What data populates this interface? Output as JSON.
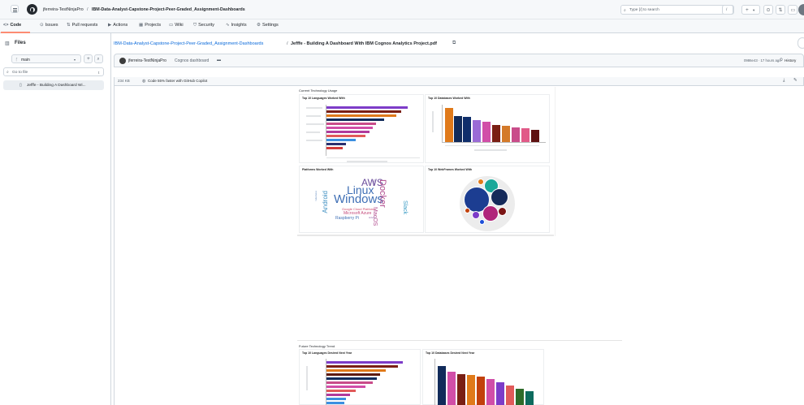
{
  "header": {
    "owner": "jferreira-TestNinjaPro",
    "separator": "/",
    "repo": "IBM-Data-Analyst-Capstone-Project-Peer-Graded_Assignment-Dashboards",
    "search_placeholder": "Type [/] to search",
    "search_hint": "/",
    "plus_label": "+",
    "caret": "▾"
  },
  "nav": {
    "tabs": [
      {
        "icon": "<>",
        "label": "Code"
      },
      {
        "icon": "⊙",
        "label": "Issues"
      },
      {
        "icon": "⇅",
        "label": "Pull requests"
      },
      {
        "icon": "▶",
        "label": "Actions"
      },
      {
        "icon": "▦",
        "label": "Projects"
      },
      {
        "icon": "▭",
        "label": "Wiki"
      },
      {
        "icon": "⛉",
        "label": "Security"
      },
      {
        "icon": "∿",
        "label": "Insights"
      },
      {
        "icon": "⚙",
        "label": "Settings"
      }
    ]
  },
  "sidebar": {
    "title": "Files",
    "branch": "main",
    "search_placeholder": "Go to file",
    "search_key": "t",
    "file": "Jefffe - Building A Dashboard Wi..."
  },
  "breadcrumb": {
    "repo": "IBM-Data-Analyst-Capstone-Project-Peer-Graded_Assignment-Dashboards",
    "sep": "/",
    "file": "Jefffe - Building A Dashboard With IBM Cognos Analytics Project.pdf"
  },
  "commit": {
    "author": "jferreira-TestNinjaPro",
    "message": "Cognos dashboard",
    "hash": "0986e43 · 17 hours ago",
    "history": "History"
  },
  "filebar": {
    "size": "234 KB",
    "copilot": "Code 55% faster with GitHub Copilot"
  },
  "pdf": {
    "section1": "Current Technology Usage",
    "section2": "Future Technology Trend",
    "panels": {
      "langs": "Top 10 Languages Worked With",
      "dbs": "Top 10 Databases Worked With",
      "platforms": "Platforms Worked With",
      "webframes": "Top 10 WebFrames Worked With",
      "langs_next": "Top 10 Languages Desired Next Year",
      "dbs_next": "Top 10 Databases Desired Next Year"
    },
    "words": [
      {
        "t": "AWS",
        "c": "#6a4c9c"
      },
      {
        "t": "Linux",
        "c": "#3f6fb5"
      },
      {
        "t": "Windows",
        "c": "#3f6fb5"
      },
      {
        "t": "Docker",
        "c": "#b04b8e"
      },
      {
        "t": "Android",
        "c": "#3f8fc1"
      },
      {
        "t": "Slack",
        "c": "#3a9bc4"
      },
      {
        "t": "MacOS",
        "c": "#b04b8e"
      },
      {
        "t": "Google Cloud Platform",
        "c": "#d14a6a"
      },
      {
        "t": "Microsoft Azure",
        "c": "#c44a7a"
      },
      {
        "t": "Raspberry Pi",
        "c": "#3f6fb5"
      },
      {
        "t": "Kubernetes",
        "c": "#6a8fc1"
      },
      {
        "t": "Heroku",
        "c": "#6a4c9c"
      },
      {
        "t": "Arduino",
        "c": "#8b5a9f"
      }
    ]
  },
  "colors": {
    "accent": "#0969da",
    "tab_underline": "#fd8c73",
    "purple": "#7d3cc8",
    "darkred": "#7a1f14",
    "orange": "#e07a1a",
    "navy": "#112b5a",
    "pink": "#d14ea8",
    "salmon": "#e15a5a",
    "blue": "#3b8fe0",
    "teal": "#1aa89a"
  }
}
